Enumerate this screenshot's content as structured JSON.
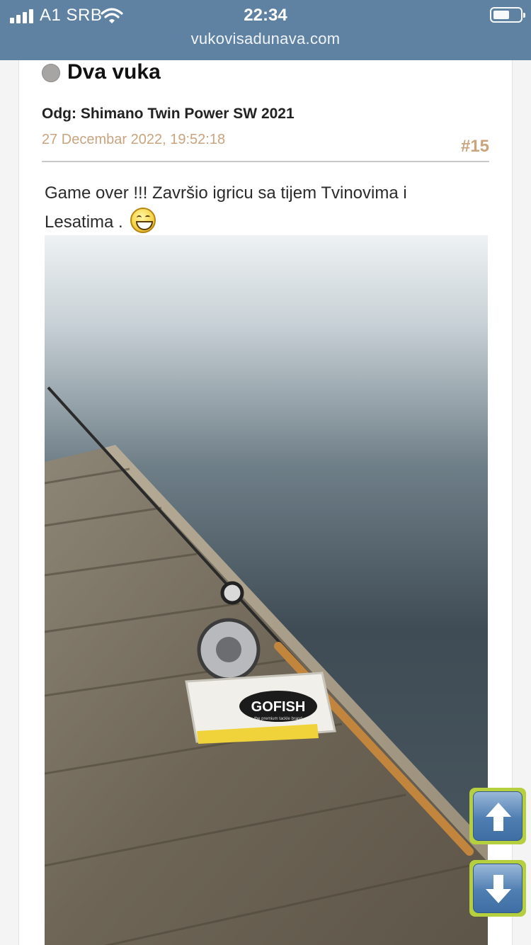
{
  "status_bar": {
    "carrier": "A1 SRB",
    "time": "22:34",
    "icons": [
      "signal-icon",
      "wifi-icon",
      "battery-icon"
    ]
  },
  "browser": {
    "url": "vukovisadunava.com"
  },
  "post": {
    "author": "Dva vuka",
    "author_status": "offline",
    "title": "Odg: Shimano Twin Power SW 2021",
    "date": "27 Decembar 2022, 19:52:18",
    "number": "#15",
    "body_line1": "Game over !!! Završio igricu sa tijem Tvinovima i",
    "body_line2": "Lesatima .",
    "emoji": "laughing-smiley-icon",
    "image": {
      "brand_label": "GOFISH",
      "brand_tagline": "the premium tackle brand"
    }
  },
  "navigation": {
    "scroll_up": "arrow-up-icon",
    "scroll_down": "arrow-down-icon"
  },
  "colors": {
    "header_bar": "#5f82a3",
    "date_accent": "#c9a47e",
    "scroll_button_border": "#b6cf3f",
    "scroll_button_fill": "#4f7eb2"
  }
}
